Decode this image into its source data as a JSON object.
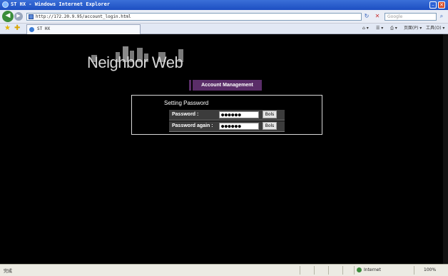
{
  "window": {
    "title": "ST HX - Windows Internet Explorer"
  },
  "navbar": {
    "address": "http://172.20.9.95/account_login.html",
    "search_placeholder": "Google"
  },
  "tabs": [
    {
      "label": "ST HX"
    }
  ],
  "toolbar": {
    "page_label": "页面(P)",
    "tools_label": "工具(O)"
  },
  "logo": {
    "text": "Neighbor Web"
  },
  "header": {
    "account_management": "Account Management"
  },
  "panel": {
    "title": "Setting Password",
    "rows": [
      {
        "label": "Password :",
        "value": "●●●●●●",
        "button": "Bols"
      },
      {
        "label": "Password again :",
        "value": "●●●●●●",
        "button": "Bols"
      }
    ]
  },
  "statusbar": {
    "left_text": "完成",
    "zone_text": "Internet",
    "zoom_text": "100%"
  }
}
